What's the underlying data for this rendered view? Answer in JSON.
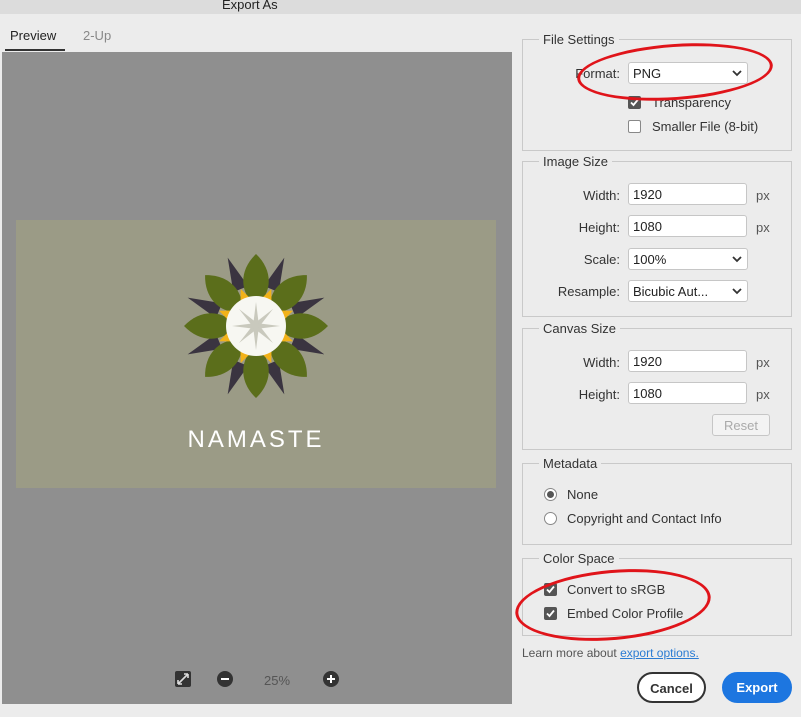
{
  "window": {
    "title": "Export As"
  },
  "tabs": [
    {
      "label": "Preview"
    },
    {
      "label": "2-Up"
    }
  ],
  "preview": {
    "image_text": "NAMASTE",
    "zoom": "25%"
  },
  "file_settings": {
    "legend": "File Settings",
    "format_label": "Format:",
    "format_value": "PNG",
    "transparency_label": "Transparency",
    "transparency_checked": true,
    "smaller_file_label": "Smaller File (8-bit)",
    "smaller_file_checked": false
  },
  "image_size": {
    "legend": "Image Size",
    "width_label": "Width:",
    "width_value": "1920",
    "width_unit": "px",
    "height_label": "Height:",
    "height_value": "1080",
    "height_unit": "px",
    "scale_label": "Scale:",
    "scale_value": "100%",
    "resample_label": "Resample:",
    "resample_value": "Bicubic Aut..."
  },
  "canvas_size": {
    "legend": "Canvas Size",
    "width_label": "Width:",
    "width_value": "1920",
    "width_unit": "px",
    "height_label": "Height:",
    "height_value": "1080",
    "height_unit": "px",
    "reset_label": "Reset"
  },
  "metadata": {
    "legend": "Metadata",
    "options": [
      {
        "label": "None",
        "selected": true
      },
      {
        "label": "Copyright and Contact Info",
        "selected": false
      }
    ]
  },
  "color_space": {
    "legend": "Color Space",
    "convert_label": "Convert to sRGB",
    "convert_checked": true,
    "embed_label": "Embed Color Profile",
    "embed_checked": true
  },
  "footer": {
    "learn_text": "Learn more about",
    "learn_link": "export options.",
    "cancel_label": "Cancel",
    "export_label": "Export"
  },
  "colors": {
    "accent": "#1d76e0",
    "annotation": "#e0141a",
    "preview_bg": "#8f8f8f",
    "image_bg": "#9b9b86"
  }
}
